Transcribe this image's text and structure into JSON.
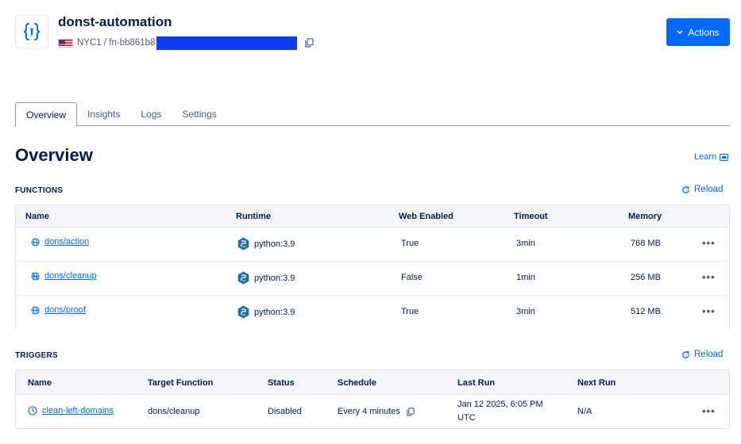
{
  "header": {
    "title": "donst-automation",
    "region": "NYC1 / fn-bb861b8",
    "actions_label": "Actions"
  },
  "tabs": [
    {
      "label": "Overview",
      "active": true
    },
    {
      "label": "Insights",
      "active": false
    },
    {
      "label": "Logs",
      "active": false
    },
    {
      "label": "Settings",
      "active": false
    }
  ],
  "overview": {
    "title": "Overview",
    "learn_label": "Learn"
  },
  "functions": {
    "section_title": "FUNCTIONS",
    "reload_label": "Reload",
    "columns": [
      "Name",
      "Runtime",
      "Web Enabled",
      "Timeout",
      "Memory"
    ],
    "rows": [
      {
        "name": "dons/action",
        "icon": "globe-icon",
        "runtime": "python:3.9",
        "web_enabled": "True",
        "timeout": "3min",
        "memory": "768 MB"
      },
      {
        "name": "dons/cleanup",
        "icon": "globe-disabled-icon",
        "runtime": "python:3.9",
        "web_enabled": "False",
        "timeout": "1min",
        "memory": "256 MB"
      },
      {
        "name": "dons/proof",
        "icon": "globe-icon",
        "runtime": "python:3.9",
        "web_enabled": "True",
        "timeout": "3min",
        "memory": "512 MB"
      }
    ]
  },
  "triggers": {
    "section_title": "TRIGGERS",
    "reload_label": "Reload",
    "columns": [
      "Name",
      "Target Function",
      "Status",
      "Schedule",
      "Last Run",
      "Next Run"
    ],
    "rows": [
      {
        "name": "clean-left-domains",
        "icon": "clock-icon",
        "target": "dons/cleanup",
        "status": "Disabled",
        "schedule": "Every 4 minutes",
        "last_run_line1": "Jan 12 2025, 6:05 PM",
        "last_run_line2": "UTC",
        "next_run": "N/A"
      }
    ]
  },
  "more_label": "•••",
  "colors": {
    "accent": "#0069ff",
    "text": "#031b4e",
    "muted": "#4d5b7c",
    "python": "#1f6fae"
  }
}
